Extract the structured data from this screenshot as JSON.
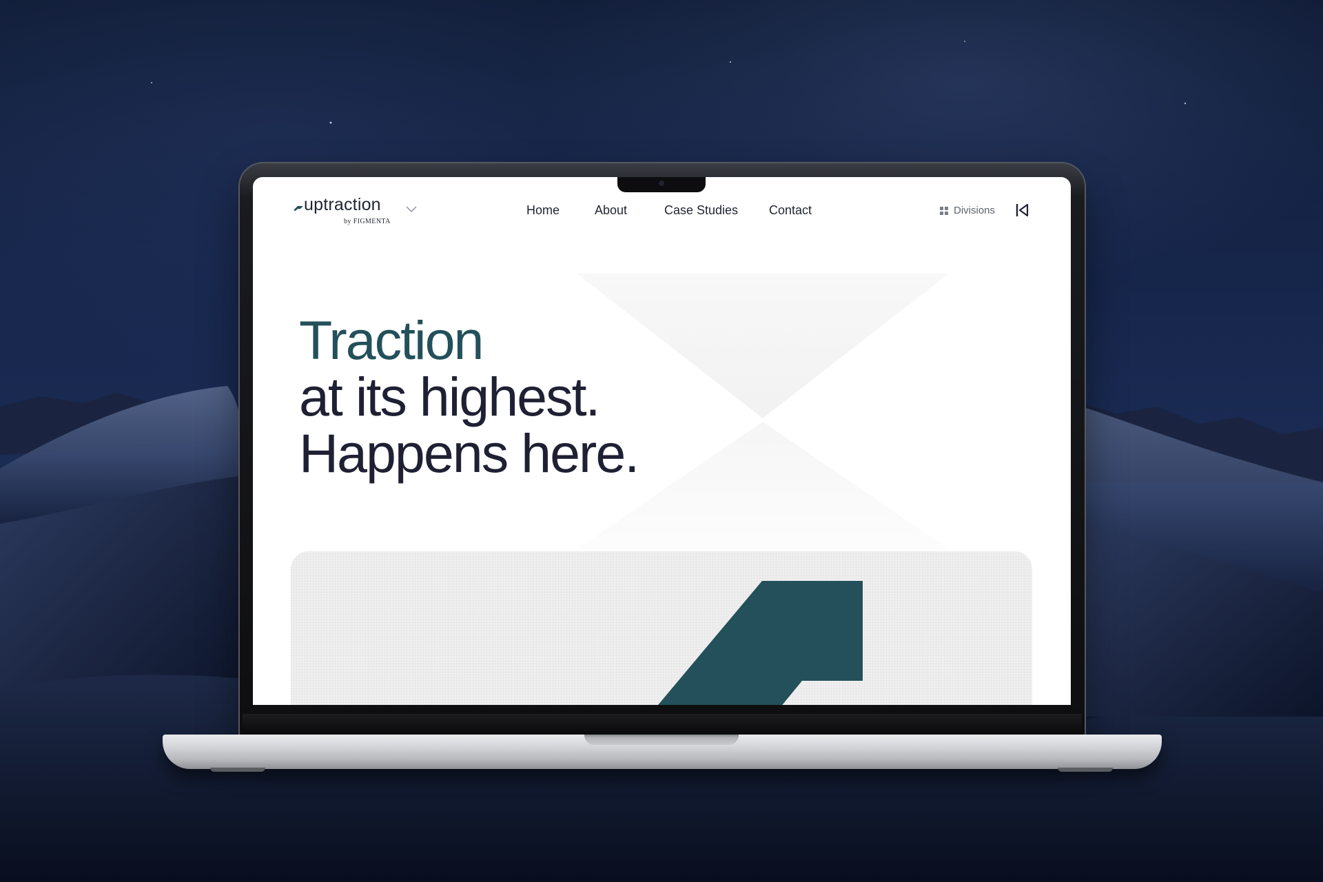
{
  "brand": {
    "name": "uptraction",
    "byline": "by FIGMENTA",
    "accent_color": "#23505a",
    "text_color": "#1f2033"
  },
  "nav": {
    "items": [
      {
        "label": "Home"
      },
      {
        "label": "About"
      },
      {
        "label": "Case Studies"
      },
      {
        "label": "Contact"
      }
    ]
  },
  "header": {
    "divisions_label": "Divisions",
    "divisions_icon": "grid-icon",
    "back_icon": "skip-back-icon",
    "brand_dropdown_icon": "chevron-down-icon"
  },
  "hero": {
    "line1": "Traction",
    "line2": "at its highest.",
    "line3": "Happens here."
  }
}
